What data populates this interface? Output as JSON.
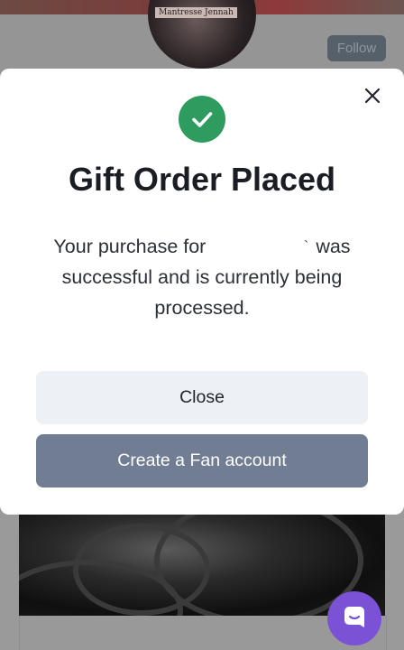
{
  "background": {
    "avatar_caption": "Mantresse Jennah",
    "follow_label": "Follow"
  },
  "modal": {
    "title": "Gift Order Placed",
    "message_before": "Your purchase for",
    "message_after": "was successful and is currently being processed.",
    "close_button_label": "Close",
    "create_account_label": "Create a Fan account",
    "icons": {
      "close": "close-icon",
      "success": "check-circle-icon"
    }
  },
  "colors": {
    "success_green": "#2e9b5f",
    "primary_button": "#707d93",
    "secondary_button": "#edf1f5",
    "chat_purple": "#7b52d6"
  },
  "chat": {
    "icon": "chat-bubble-icon"
  }
}
